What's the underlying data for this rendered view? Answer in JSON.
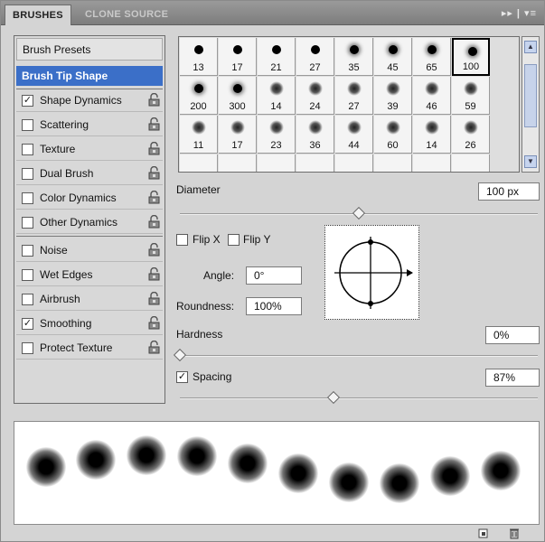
{
  "tabs": [
    {
      "label": "BRUSHES"
    },
    {
      "label": "CLONE SOURCE"
    }
  ],
  "tab_controls": "▸▸ | ▾≡",
  "options": {
    "presets_label": "Brush Presets",
    "tip_shape_label": "Brush Tip Shape",
    "items": [
      {
        "label": "Shape Dynamics",
        "checked": true
      },
      {
        "label": "Scattering",
        "checked": false
      },
      {
        "label": "Texture",
        "checked": false
      },
      {
        "label": "Dual Brush",
        "checked": false
      },
      {
        "label": "Color Dynamics",
        "checked": false
      },
      {
        "label": "Other Dynamics",
        "checked": false
      },
      {
        "label": "Noise",
        "checked": false
      },
      {
        "label": "Wet Edges",
        "checked": false
      },
      {
        "label": "Airbrush",
        "checked": false
      },
      {
        "label": "Smoothing",
        "checked": true
      },
      {
        "label": "Protect Texture",
        "checked": false
      }
    ]
  },
  "brushes": {
    "row1": [
      "13",
      "17",
      "21",
      "27",
      "35",
      "45",
      "65",
      "100"
    ],
    "row2": [
      "200",
      "300",
      "14",
      "24",
      "27",
      "39",
      "46",
      "59"
    ],
    "row3": [
      "11",
      "17",
      "23",
      "36",
      "44",
      "60",
      "14",
      "26"
    ],
    "selected_index": 7
  },
  "controls": {
    "diameter_label": "Diameter",
    "diameter_value": "100 px",
    "flip_x_label": "Flip X",
    "flip_y_label": "Flip Y",
    "angle_label": "Angle:",
    "angle_value": "0°",
    "roundness_label": "Roundness:",
    "roundness_value": "100%",
    "hardness_label": "Hardness",
    "hardness_value": "0%",
    "spacing_label": "Spacing",
    "spacing_value": "87%",
    "spacing_checked": true,
    "diameter_level": 0.5,
    "hardness_level": 0.0,
    "spacing_level": 0.43
  },
  "colors": {
    "selection": "#3b6fc8",
    "tab_bar": "#8a8a8a"
  },
  "icons": {
    "lock": "lock-icon",
    "new_preset": "new-preset-icon",
    "delete": "trash-icon"
  }
}
